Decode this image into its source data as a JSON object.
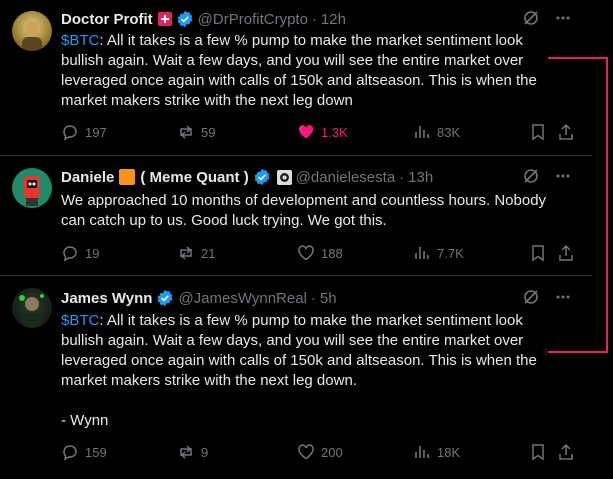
{
  "tweets": [
    {
      "name": "Doctor Profit",
      "handle": "@DrProfitCrypto",
      "time": "12h",
      "text_prefix": "$BTC",
      "text_rest": ": All it takes is a few % pump to make the market sentiment look bullish again. Wait a few days, and you will see the entire market over leveraged once again with calls of 150k and altseason. This is when the market makers strike with the next leg down",
      "replies": "197",
      "reposts": "59",
      "likes": "1.3K",
      "views": "83K"
    },
    {
      "name": "Daniele",
      "name_suffix": "( Meme Quant )",
      "handle": "@danielesesta",
      "time": "13h",
      "text": "We approached 10 months of development and countless hours. Nobody can catch up to us. Good luck trying. We got this.",
      "replies": "19",
      "reposts": "21",
      "likes": "188",
      "views": "7.7K"
    },
    {
      "name": "James Wynn",
      "handle": "@JamesWynnReal",
      "time": "5h",
      "text_prefix": "$BTC",
      "text_rest": ": All it takes is a few % pump to make the market sentiment look bullish again. Wait a few days, and you will see the entire market over leveraged once again with calls of 150k and altseason. This is when the market makers strike with the next leg down.\n\n- Wynn",
      "replies": "159",
      "reposts": "9",
      "likes": "200",
      "views": "18K"
    }
  ],
  "colors": {
    "accent": "#1d9bf0",
    "like": "#f91880",
    "muted": "#71767b",
    "annotation": "#e0245e"
  }
}
